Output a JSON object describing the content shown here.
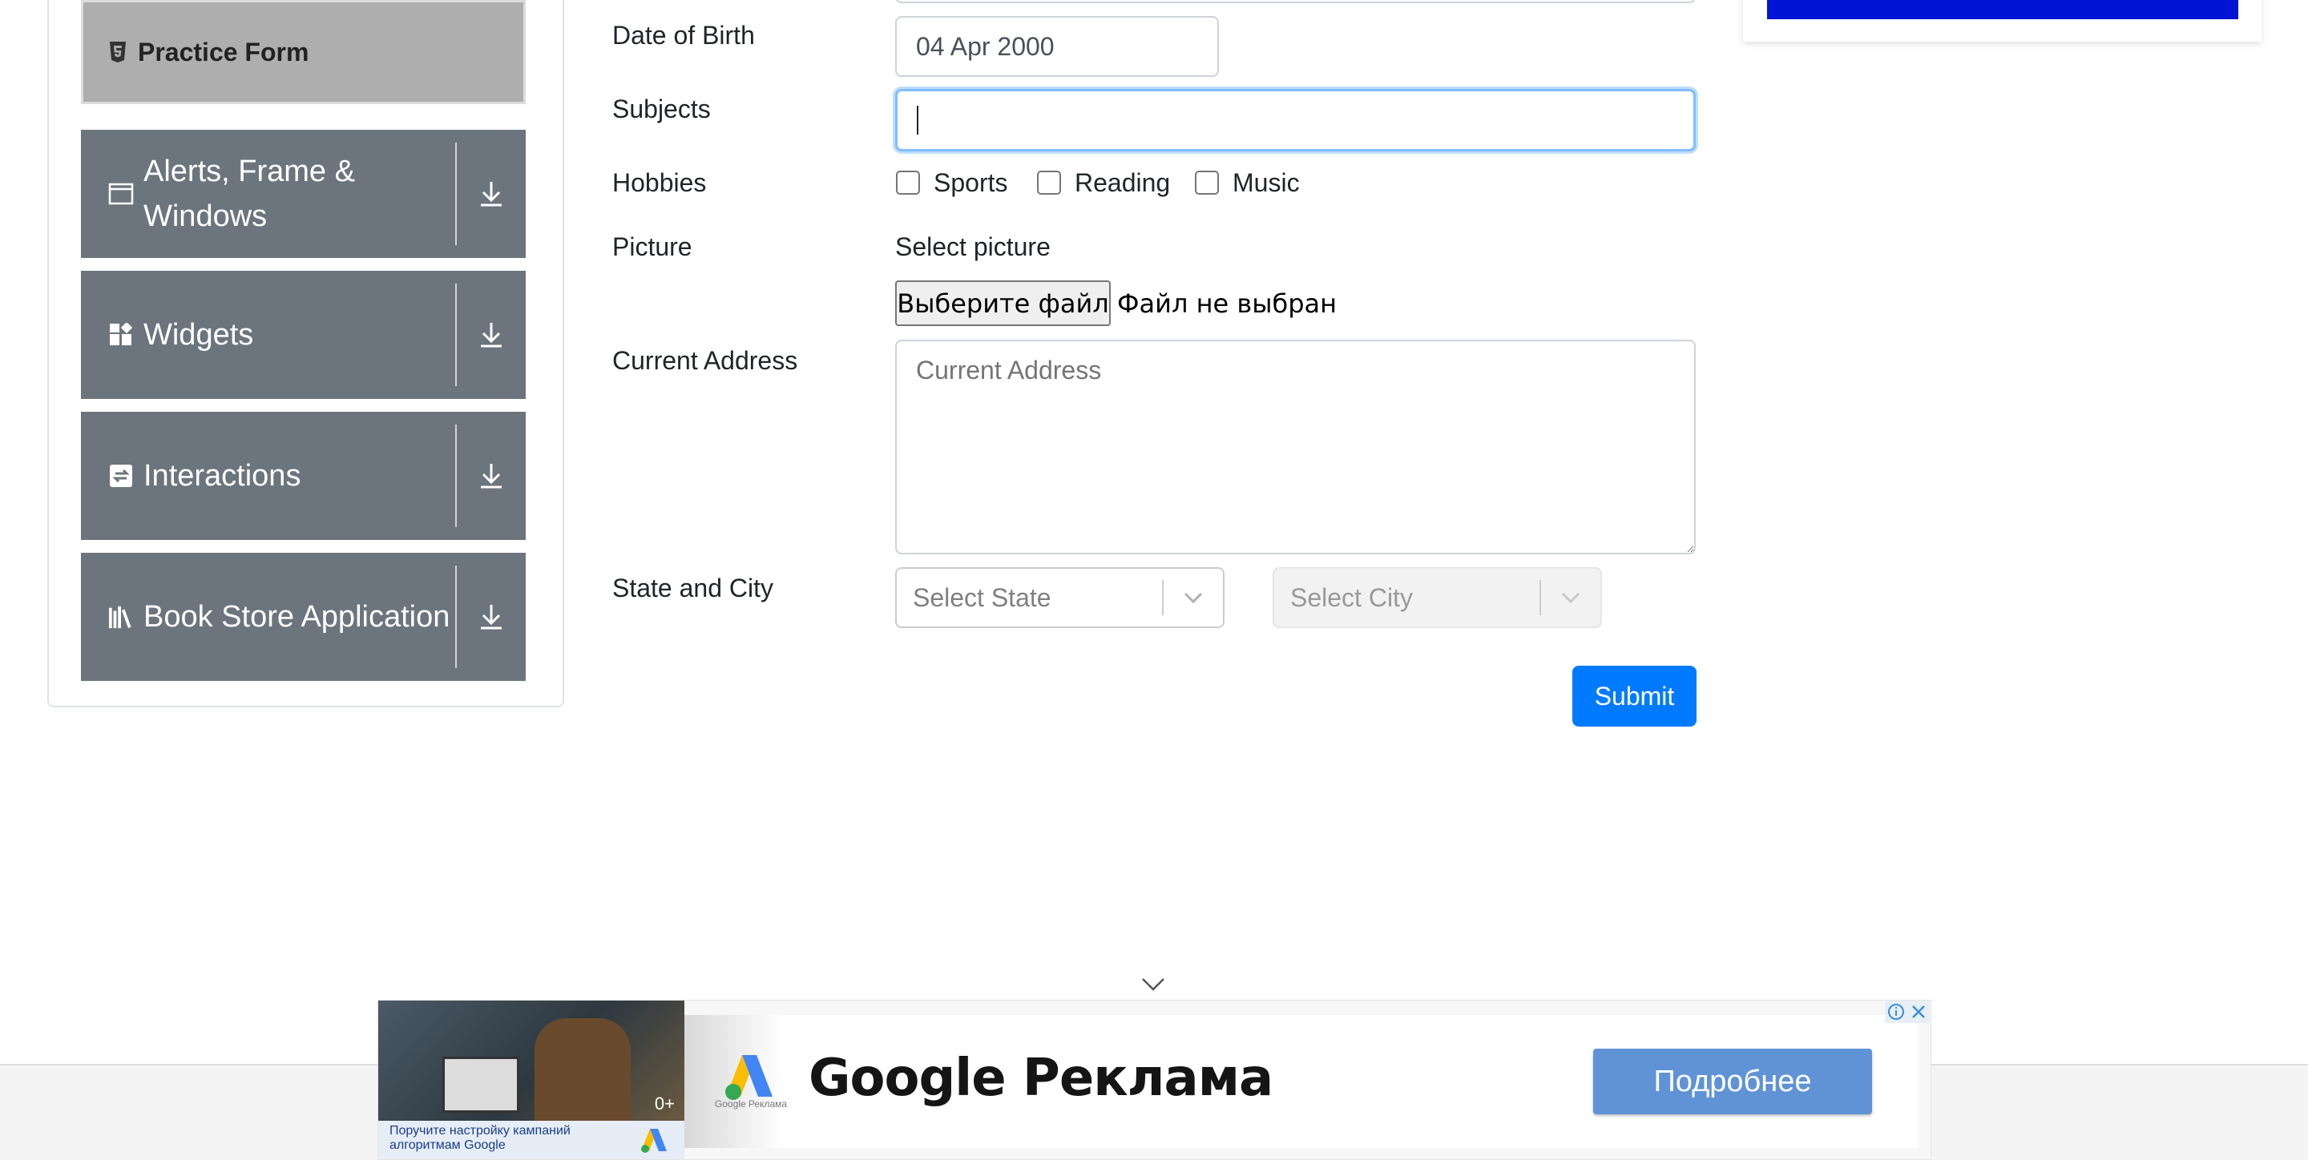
{
  "sidebar": {
    "active_item": "Practice Form",
    "groups": [
      {
        "label": "Alerts, Frame &",
        "label2": "Windows",
        "icon": "window-icon"
      },
      {
        "label": "Widgets",
        "icon": "widgets-icon"
      },
      {
        "label": "Interactions",
        "icon": "interactions-icon"
      },
      {
        "label": "Book Store Application",
        "icon": "books-icon"
      }
    ]
  },
  "form": {
    "dob_label": "Date of Birth",
    "dob_value": "04 Apr 2000",
    "subjects_label": "Subjects",
    "hobbies_label": "Hobbies",
    "hobbies": [
      "Sports",
      "Reading",
      "Music"
    ],
    "picture_label": "Picture",
    "picture_caption": "Select picture",
    "file_button": "Выберите файл",
    "file_status": "Файл не выбран",
    "address_label": "Current Address",
    "address_placeholder": "Current Address",
    "state_city_label": "State and City",
    "state_placeholder": "Select State",
    "city_placeholder": "Select City",
    "submit_label": "Submit"
  },
  "ad": {
    "photo_badge": "0+",
    "caption": "Поручите настройку кампаний алгоритмам Google",
    "logo_caption": "Google Реклама",
    "title": "Google Реклама",
    "cta": "Подробнее"
  },
  "colors": {
    "primary": "#007bff",
    "sidebar_group": "#6c757d",
    "sidebar_active": "#aeaeae",
    "ad_cta": "#5f93d6"
  }
}
